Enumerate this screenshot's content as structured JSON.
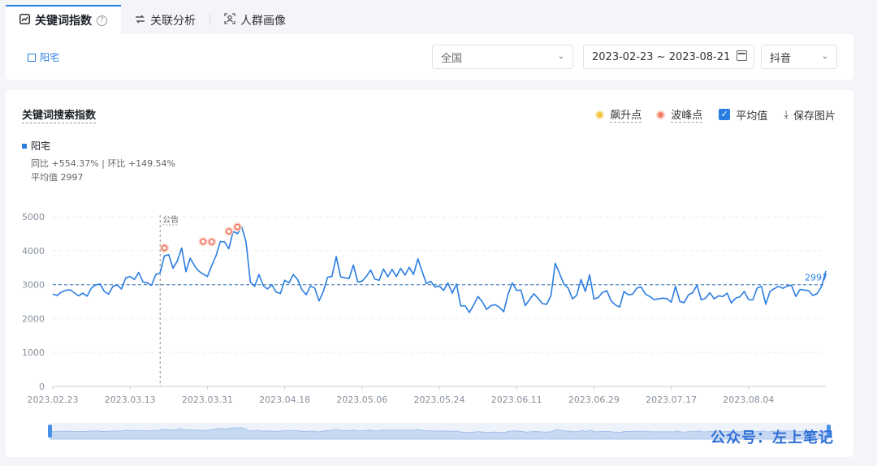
{
  "tabs": [
    {
      "label": "关键词指数",
      "icon": "trend-chart-icon",
      "active": true
    },
    {
      "label": "关联分析",
      "icon": "relation-icon",
      "active": false
    },
    {
      "label": "人群画像",
      "icon": "user-scan-icon",
      "active": false
    }
  ],
  "filter": {
    "keyword": "阳宅",
    "region": "全国",
    "date_range": "2023-02-23 ~ 2023-08-21",
    "platform": "抖音"
  },
  "panel": {
    "title": "关键词搜索指数",
    "tools": {
      "surge_label": "飙升点",
      "peak_label": "波峰点",
      "average_label": "平均值",
      "save_label": "保存图片"
    },
    "legend_name": "阳宅",
    "stat_line": "同比 +554.37% | 环比 +149.54%",
    "avg_line": "平均值 2997"
  },
  "watermark": "公众号：左上笔记",
  "chart_data": {
    "type": "line",
    "x_labels": [
      "2023.02.23",
      "2023.03.13",
      "2023.03.31",
      "2023.04.18",
      "2023.05.06",
      "2023.05.24",
      "2023.06.11",
      "2023.06.29",
      "2023.07.17",
      "2023.08.04"
    ],
    "y_ticks": [
      0,
      1000,
      2000,
      3000,
      4000,
      5000
    ],
    "ylim": [
      0,
      5000
    ],
    "average": 2997,
    "average_label": "2997",
    "annotation": {
      "label": "公告",
      "day": 25
    },
    "peaks": [
      {
        "day": 26,
        "value": 4080
      },
      {
        "day": 35,
        "value": 4270
      },
      {
        "day": 37,
        "value": 4260
      },
      {
        "day": 41,
        "value": 4570
      },
      {
        "day": 43,
        "value": 4700
      }
    ],
    "series": [
      {
        "name": "阳宅",
        "values": [
          2720,
          2680,
          2780,
          2830,
          2850,
          2760,
          2670,
          2750,
          2660,
          2900,
          2990,
          3020,
          2800,
          2720,
          2950,
          2990,
          2870,
          3200,
          3240,
          3150,
          3360,
          3080,
          3050,
          2980,
          3300,
          3350,
          3850,
          3880,
          3480,
          3700,
          4080,
          3380,
          3780,
          3560,
          3400,
          3310,
          3240,
          3560,
          3850,
          4270,
          4260,
          4060,
          4570,
          4500,
          4700,
          4260,
          3080,
          2950,
          3300,
          2970,
          2870,
          3000,
          2780,
          2740,
          3130,
          3050,
          3300,
          3150,
          2850,
          2700,
          2960,
          2900,
          2520,
          2800,
          3220,
          3240,
          3830,
          3230,
          3200,
          3180,
          3580,
          3080,
          3100,
          3240,
          3430,
          3160,
          3130,
          3460,
          3230,
          3450,
          3240,
          3480,
          3280,
          3510,
          3300,
          3760,
          3390,
          3030,
          3100,
          2930,
          2960,
          2830,
          3050,
          2750,
          3020,
          2370,
          2380,
          2180,
          2400,
          2650,
          2500,
          2270,
          2380,
          2410,
          2330,
          2200,
          2710,
          3050,
          2830,
          2840,
          2380,
          2560,
          2730,
          2600,
          2440,
          2420,
          2680,
          3630,
          3330,
          3020,
          2900,
          2580,
          2690,
          3150,
          2800,
          3290,
          2580,
          2620,
          2770,
          2820,
          2520,
          2400,
          2340,
          2800,
          2700,
          2720,
          2900,
          2930,
          2720,
          2650,
          2560,
          2580,
          2600,
          2590,
          2480,
          2950,
          2500,
          2470,
          2700,
          2760,
          2980,
          2550,
          2600,
          2760,
          2580,
          2670,
          2650,
          2750,
          2460,
          2600,
          2640,
          2800,
          2560,
          2550,
          2900,
          2950,
          2420,
          2800,
          2880,
          2950,
          2890,
          2960,
          2980,
          2650,
          2860,
          2840,
          2820,
          2680,
          2740,
          2950,
          3400
        ]
      }
    ]
  }
}
